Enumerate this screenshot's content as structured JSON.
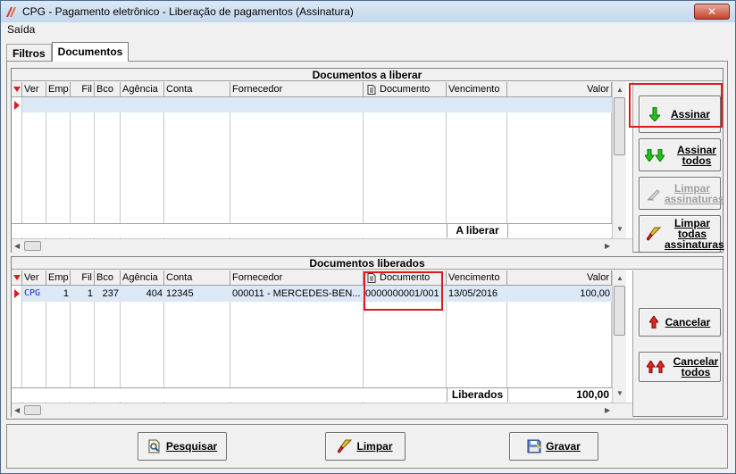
{
  "window": {
    "title": "CPG - Pagamento eletrônico - Liberação de pagamentos (Assinatura)",
    "close_label": "✕"
  },
  "menu": {
    "saida": "Saída"
  },
  "tabs": [
    {
      "label": "Filtros"
    },
    {
      "label": "Documentos"
    }
  ],
  "columns": [
    "Ver",
    "Emp",
    "Fil",
    "Bco",
    "Agência",
    "Conta",
    "Fornecedor",
    "Documento",
    "Vencimento",
    "Valor"
  ],
  "panel_liberar": {
    "title": "Documentos a liberar",
    "totals_label": "A liberar",
    "totals_value": ""
  },
  "panel_liberados": {
    "title": "Documentos liberados",
    "totals_label": "Liberados",
    "totals_value": "100,00",
    "row": {
      "ver": "CPG",
      "emp": "1",
      "fil": "1",
      "bco": "237",
      "agencia": "404",
      "conta": "12345",
      "fornecedor": "000011 - MERCEDES-BEN...",
      "documento": "0000000001/001",
      "vencimento": "13/05/2016",
      "valor": "100,00"
    }
  },
  "buttons": {
    "assinar": "Assinar",
    "assinar_todos_1": "Assinar",
    "assinar_todos_2": "todos",
    "limpar_assin_1": "Limpar",
    "limpar_assin_2": "assinaturas",
    "limpar_todas_1": "Limpar",
    "limpar_todas_2": "todas",
    "limpar_todas_3": "assinaturas",
    "cancelar": "Cancelar",
    "cancelar_todos_1": "Cancelar",
    "cancelar_todos_2": "todos",
    "pesquisar": "Pesquisar",
    "limpar": "Limpar",
    "gravar": "Gravar"
  },
  "colors": {
    "highlight": "#e0191e",
    "row_selected": "#dce8f6",
    "cpg_text": "#1a2ad0"
  }
}
